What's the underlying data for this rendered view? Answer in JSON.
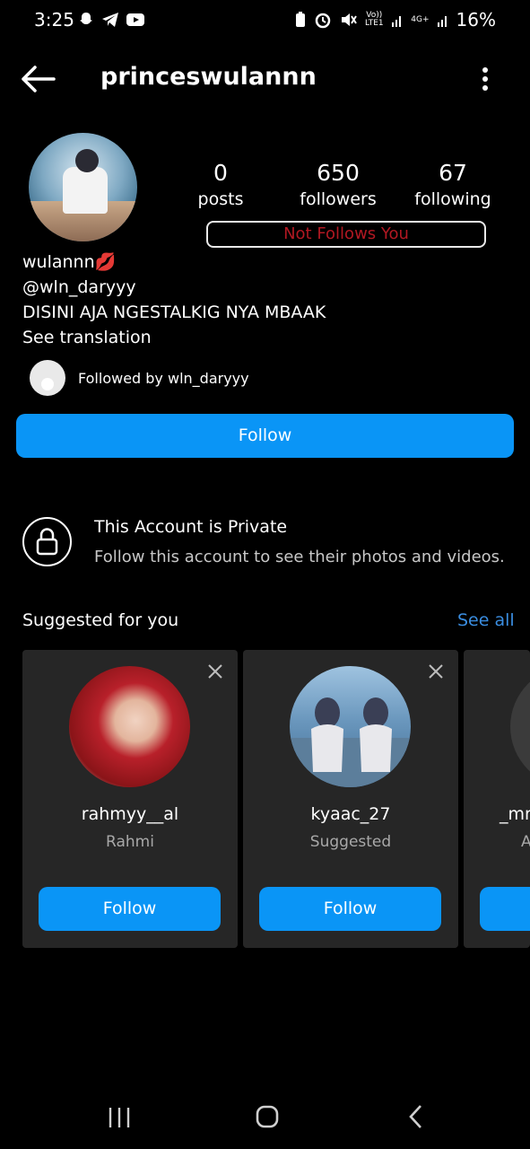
{
  "status_bar": {
    "time": "3:25",
    "network": "Vo)) LTE1",
    "network_type": "4G+",
    "battery": "16%"
  },
  "header": {
    "username": "princeswulannn"
  },
  "profile": {
    "stats": {
      "posts_count": "0",
      "posts_label": "posts",
      "followers_count": "650",
      "followers_label": "followers",
      "following_count": "67",
      "following_label": "following"
    },
    "not_follows_badge": "Not Follows You",
    "display_name": "wulannn",
    "handle": "@wln_daryyy",
    "bio": "DISINI AJA NGESTALKIG NYA MBAAK",
    "see_translation": "See translation",
    "followed_by": "Followed by wln_daryyy",
    "follow_button": "Follow"
  },
  "private_notice": {
    "title": "This Account is Private",
    "subtitle": "Follow this account to see their photos and videos."
  },
  "suggestions": {
    "title": "Suggested for you",
    "see_all": "See all",
    "cards": [
      {
        "username": "rahmyy__al",
        "subtitle": "Rahmi",
        "button": "Follow"
      },
      {
        "username": "kyaac_27",
        "subtitle": "Suggested",
        "button": "Follow"
      },
      {
        "username": "_mr",
        "subtitle": "A",
        "button": ""
      }
    ]
  },
  "colors": {
    "background": "#000000",
    "accent_blue": "#0a95f6",
    "link_blue": "#3a8de0",
    "not_follows_red": "#b11822",
    "card_bg": "#262626"
  }
}
